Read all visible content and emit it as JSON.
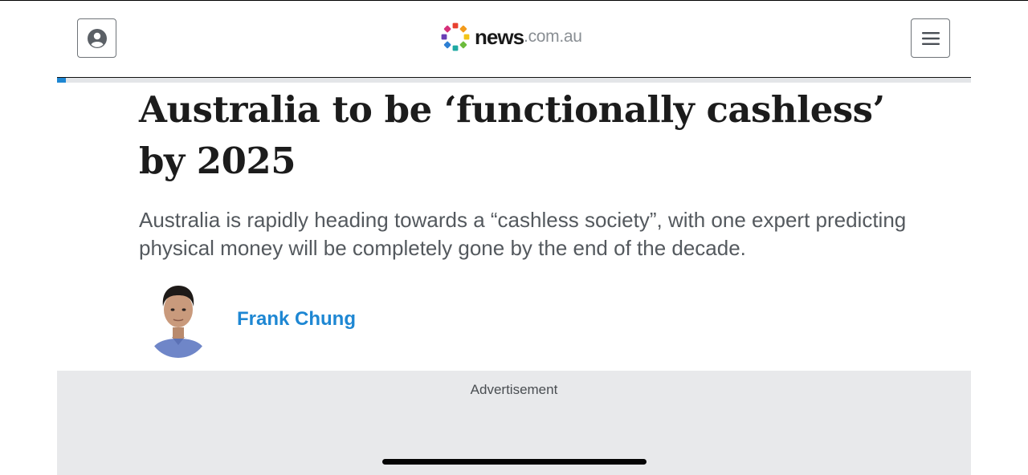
{
  "header": {
    "account_icon": "account-circle-icon",
    "menu_icon": "hamburger-menu-icon",
    "logo": {
      "brand": "news",
      "domain": ".com.au",
      "dot_colors": [
        "#e8402f",
        "#f39b1c",
        "#f2c419",
        "#6cbb3c",
        "#1fa9a3",
        "#2d7fd3",
        "#6a3fb5",
        "#d6307a"
      ]
    }
  },
  "reading_progress": {
    "fraction": 0.01,
    "fill_color": "#1e87d3"
  },
  "article": {
    "headline": "Australia to be ‘functionally cashless’ by 2025",
    "standfirst": "Australia is rapidly heading towards a “cashless society”, with one expert predicting physical money will be completely gone by the end of the decade.",
    "author": {
      "name": "Frank Chung",
      "link_color": "#1e87d3"
    }
  },
  "advertisement": {
    "label": "Advertisement"
  }
}
